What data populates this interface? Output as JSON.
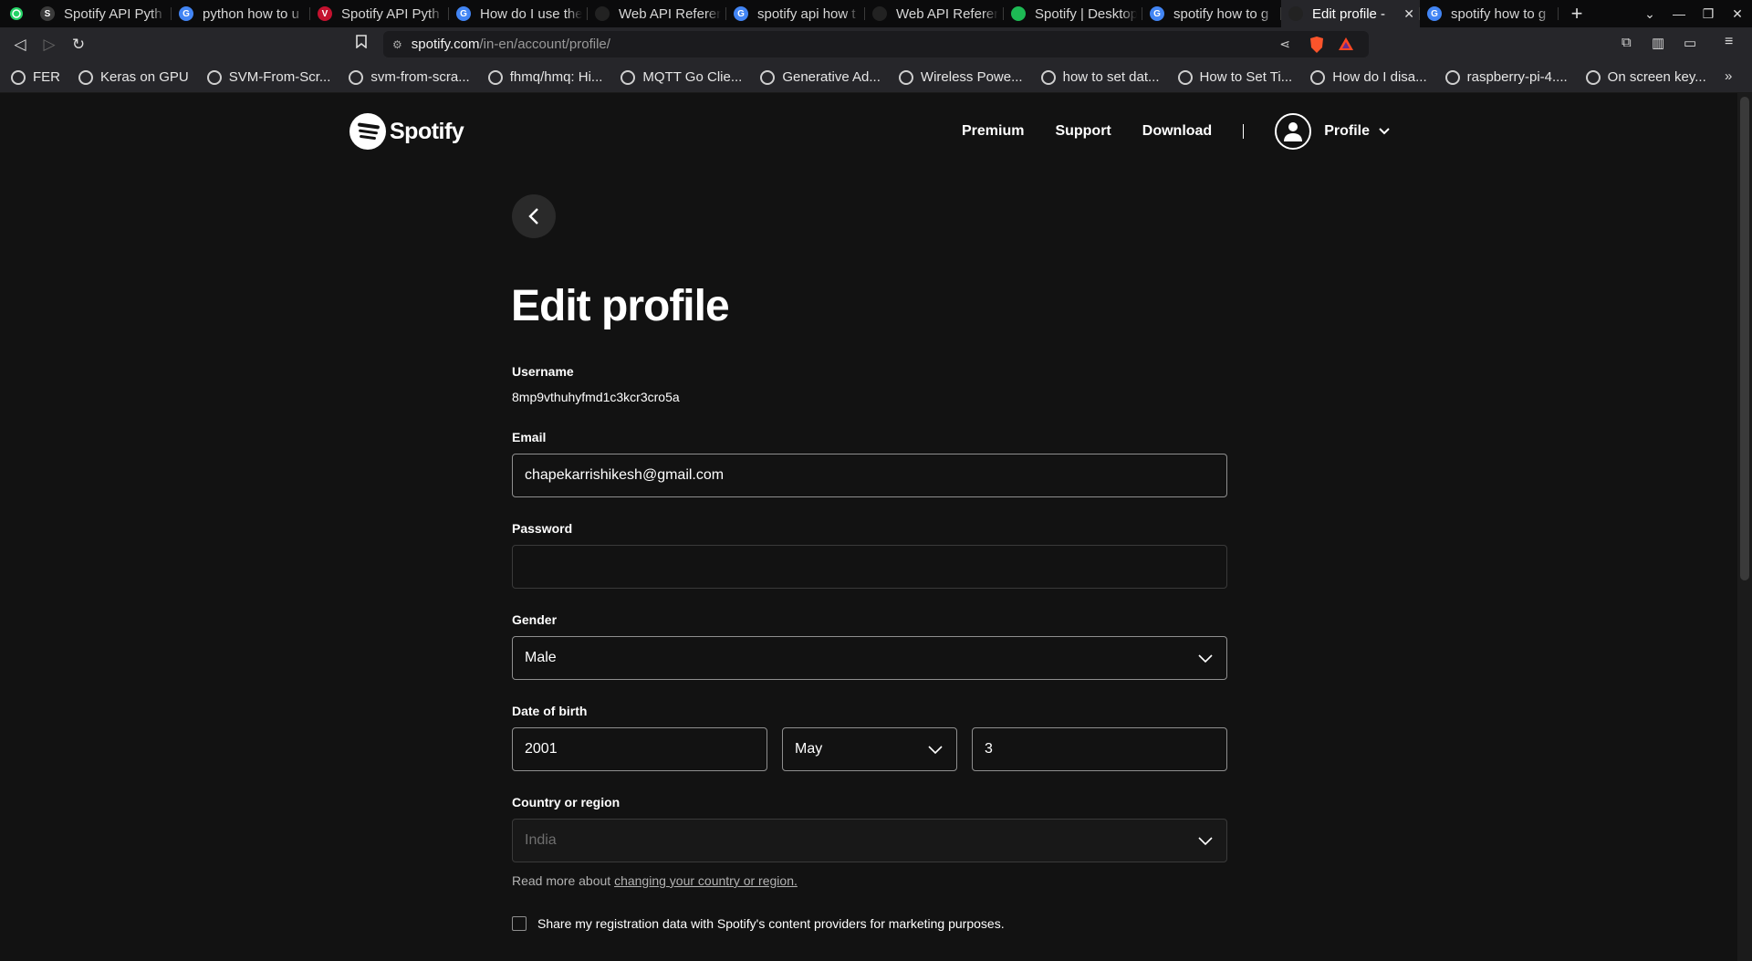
{
  "browser": {
    "tabs": [
      {
        "title": "Spotify API Pyth",
        "fav_color": "#3b3b3b",
        "fav_text": "S"
      },
      {
        "title": "python how to u",
        "fav_color": "#4285f4",
        "fav_text": "G"
      },
      {
        "title": "Spotify API Pyth",
        "fav_color": "#c4122f",
        "fav_text": "V"
      },
      {
        "title": "How do I use the",
        "fav_color": "#4285f4",
        "fav_text": "G"
      },
      {
        "title": "Web API Referen",
        "fav_color": "#222",
        "fav_text": ""
      },
      {
        "title": "spotify api how t",
        "fav_color": "#4285f4",
        "fav_text": "G"
      },
      {
        "title": "Web API Referen",
        "fav_color": "#222",
        "fav_text": ""
      },
      {
        "title": "Spotify | Desktop",
        "fav_color": "#1db954",
        "fav_text": ""
      },
      {
        "title": "spotify how to g",
        "fav_color": "#4285f4",
        "fav_text": "G"
      },
      {
        "title": "Edit profile -",
        "fav_color": "#222",
        "fav_text": "",
        "active": true
      },
      {
        "title": "spotify how to g",
        "fav_color": "#4285f4",
        "fav_text": "G"
      }
    ],
    "url_host": "spotify.com",
    "url_path": "/in-en/account/profile/",
    "bookmarks": [
      "FER",
      "Keras on GPU",
      "SVM-From-Scr...",
      "svm-from-scra...",
      "fhmq/hmq: Hi...",
      "MQTT Go Clie...",
      "Generative Ad...",
      "Wireless Powe...",
      "how to set dat...",
      "How to Set Ti...",
      "How do I disa...",
      "raspberry-pi-4....",
      "On screen key..."
    ]
  },
  "header": {
    "brand": "Spotify",
    "nav": {
      "premium": "Premium",
      "support": "Support",
      "download": "Download",
      "profile": "Profile"
    }
  },
  "main": {
    "title": "Edit profile",
    "username_label": "Username",
    "username_value": "8mp9vthuhyfmd1c3kcr3cro5a",
    "email_label": "Email",
    "email_value": "chapekarrishikesh@gmail.com",
    "password_label": "Password",
    "password_value": "",
    "gender_label": "Gender",
    "gender_value": "Male",
    "dob_label": "Date of birth",
    "dob_year": "2001",
    "dob_month": "May",
    "dob_day": "3",
    "country_label": "Country or region",
    "country_value": "India",
    "country_help_prefix": "Read more about ",
    "country_help_link": "changing your country or region.",
    "share_label": "Share my registration data with Spotify's content providers for marketing purposes."
  }
}
